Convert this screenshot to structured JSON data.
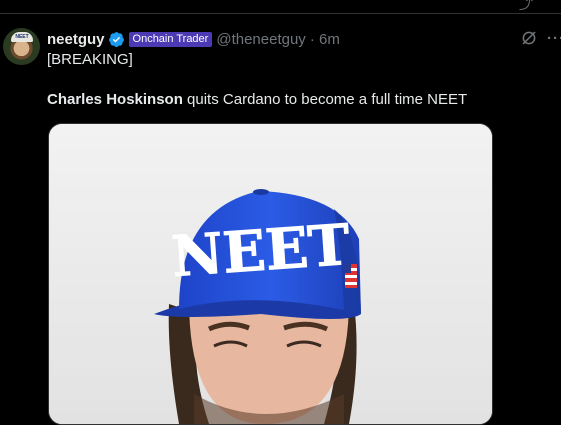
{
  "tweet": {
    "display_name": "neetguy",
    "badge": "Onchain Trader",
    "handle": "@theneetguy",
    "time": "· 6m",
    "text_line1": "[BREAKING]",
    "text_bold": "Charles Hoskinson",
    "text_rest": " quits Cardano to become a full time NEET",
    "media": {
      "cap_text": "NEET"
    }
  },
  "colors": {
    "background": "#000000",
    "text": "#e7e9ea",
    "muted": "#71767b",
    "verified": "#1d9bf0",
    "badge_bg": "#4c3ab5",
    "cap_blue": "#1f4ed8"
  },
  "icons": {
    "verified": "verified-badge-icon",
    "grok": "grok-icon",
    "more": "more-icon",
    "avatar": "avatar"
  }
}
